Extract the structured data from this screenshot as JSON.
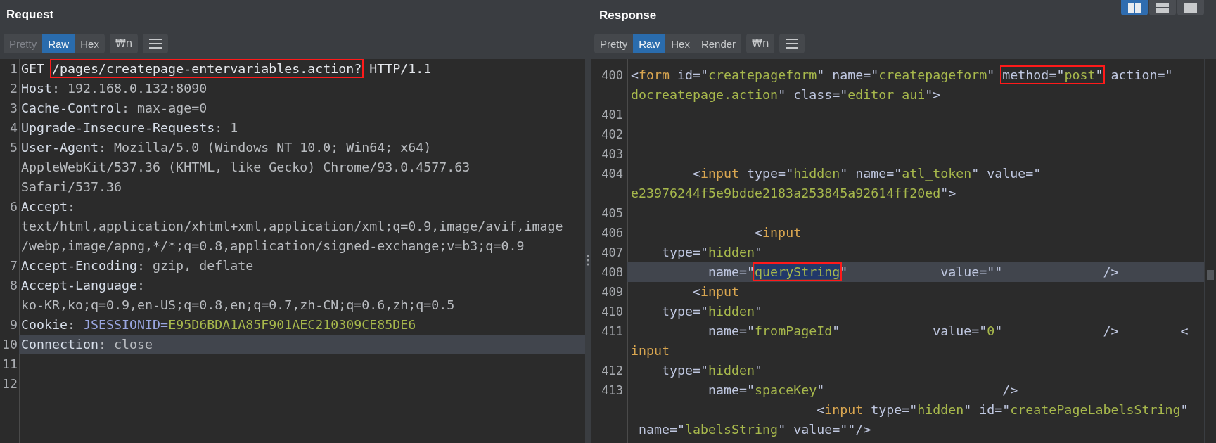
{
  "layout_buttons": [
    {
      "kind": "columns",
      "selected": true
    },
    {
      "kind": "rows",
      "selected": false
    },
    {
      "kind": "single",
      "selected": false
    }
  ],
  "request": {
    "title": "Request",
    "tabs": [
      {
        "label": "Pretty",
        "selected": false,
        "disabled": true
      },
      {
        "label": "Raw",
        "selected": true,
        "disabled": false
      },
      {
        "label": "Hex",
        "selected": false,
        "disabled": false
      }
    ],
    "wrap_button": "₩n",
    "rows": [
      {
        "number": "1",
        "current": false,
        "segments": [
          {
            "text": "GET ",
            "kind": "text"
          },
          {
            "kind": "box",
            "selected": false,
            "segments": [
              {
                "text": "/pages/createpage-entervariables.action?",
                "kind": "text"
              }
            ]
          },
          {
            "text": " HTTP/1.1",
            "kind": "text"
          }
        ]
      },
      {
        "number": "2",
        "current": false,
        "segments": [
          {
            "text": "Host",
            "kind": "name"
          },
          {
            "text": ": 192.168.0.132:8090",
            "kind": "plain"
          }
        ]
      },
      {
        "number": "3",
        "current": false,
        "segments": [
          {
            "text": "Cache-Control",
            "kind": "name"
          },
          {
            "text": ": max-age=0",
            "kind": "plain"
          }
        ]
      },
      {
        "number": "4",
        "current": false,
        "segments": [
          {
            "text": "Upgrade-Insecure-Requests",
            "kind": "name"
          },
          {
            "text": ": 1",
            "kind": "plain"
          }
        ]
      },
      {
        "number": "5",
        "current": false,
        "segments": [
          {
            "text": "User-Agent",
            "kind": "name"
          },
          {
            "text": ": Mozilla/5.0 (Windows NT 10.0; Win64; x64)",
            "kind": "plain"
          }
        ]
      },
      {
        "current": false,
        "segments": [
          {
            "text": "AppleWebKit/537.36 (KHTML, like Gecko) Chrome/93.0.4577.63",
            "kind": "plain"
          }
        ]
      },
      {
        "current": false,
        "segments": [
          {
            "text": "Safari/537.36",
            "kind": "plain"
          }
        ]
      },
      {
        "number": "6",
        "current": false,
        "segments": [
          {
            "text": "Accept",
            "kind": "name"
          },
          {
            "text": ":",
            "kind": "plain"
          }
        ]
      },
      {
        "current": false,
        "segments": [
          {
            "text": "text/html,application/xhtml+xml,application/xml;q=0.9,image/avif,image",
            "kind": "plain"
          }
        ]
      },
      {
        "current": false,
        "segments": [
          {
            "text": "/webp,image/apng,*/*;q=0.8,application/signed-exchange;v=b3;q=0.9",
            "kind": "plain"
          }
        ]
      },
      {
        "number": "7",
        "current": false,
        "segments": [
          {
            "text": "Accept-Encoding",
            "kind": "name"
          },
          {
            "text": ": gzip, deflate",
            "kind": "plain"
          }
        ]
      },
      {
        "number": "8",
        "current": false,
        "segments": [
          {
            "text": "Accept-Language",
            "kind": "name"
          },
          {
            "text": ":",
            "kind": "plain"
          }
        ]
      },
      {
        "current": false,
        "segments": [
          {
            "text": "ko-KR,ko;q=0.9,en-US;q=0.8,en;q=0.7,zh-CN;q=0.6,zh;q=0.5",
            "kind": "plain"
          }
        ]
      },
      {
        "number": "9",
        "current": false,
        "segments": [
          {
            "text": "Cookie",
            "kind": "name"
          },
          {
            "text": ": ",
            "kind": "plain"
          },
          {
            "text": "JSESSIONID=",
            "kind": "cookie_key"
          },
          {
            "text": "E95D6BDA1A85F901AEC210309CE85DE6",
            "kind": "value"
          }
        ]
      },
      {
        "number": "10",
        "current": true,
        "segments": [
          {
            "text": "Connection",
            "kind": "name"
          },
          {
            "text": ": close",
            "kind": "plain"
          }
        ]
      },
      {
        "number": "11",
        "current": false,
        "segments": []
      },
      {
        "number": "12",
        "current": false,
        "segments": []
      }
    ]
  },
  "response": {
    "title": "Response",
    "tabs": [
      {
        "label": "Pretty",
        "selected": false,
        "disabled": false
      },
      {
        "label": "Raw",
        "selected": true,
        "disabled": false
      },
      {
        "label": "Hex",
        "selected": false,
        "disabled": false
      },
      {
        "label": "Render",
        "selected": false,
        "disabled": false
      }
    ],
    "wrap_button": "₩n",
    "rows": [
      {
        "number": "400",
        "current": false,
        "segments": [
          {
            "text": "<",
            "kind": "attr"
          },
          {
            "text": "form",
            "kind": "tag"
          },
          {
            "text": " id=\"",
            "kind": "attr"
          },
          {
            "text": "createpageform",
            "kind": "value"
          },
          {
            "text": "\" name=\"",
            "kind": "attr"
          },
          {
            "text": "createpageform",
            "kind": "value"
          },
          {
            "text": "\" ",
            "kind": "attr"
          },
          {
            "kind": "box",
            "selected": false,
            "segments": [
              {
                "text": "method=\"",
                "kind": "attr"
              },
              {
                "text": "post",
                "kind": "value"
              },
              {
                "text": "\"",
                "kind": "attr"
              }
            ]
          },
          {
            "text": " action=\"",
            "kind": "attr"
          }
        ]
      },
      {
        "current": false,
        "segments": [
          {
            "text": "docreatepage.action",
            "kind": "value"
          },
          {
            "text": "\" class=\"",
            "kind": "attr"
          },
          {
            "text": "editor aui",
            "kind": "value"
          },
          {
            "text": "\">",
            "kind": "attr"
          }
        ]
      },
      {
        "number": "401",
        "current": false,
        "segments": []
      },
      {
        "number": "402",
        "current": false,
        "segments": []
      },
      {
        "number": "403",
        "current": false,
        "segments": []
      },
      {
        "number": "404",
        "current": false,
        "segments": [
          {
            "text": "        <",
            "kind": "attr"
          },
          {
            "text": "input",
            "kind": "tag"
          },
          {
            "text": " type=\"",
            "kind": "attr"
          },
          {
            "text": "hidden",
            "kind": "value"
          },
          {
            "text": "\" name=\"",
            "kind": "attr"
          },
          {
            "text": "atl_token",
            "kind": "value"
          },
          {
            "text": "\" value=\"",
            "kind": "attr"
          }
        ]
      },
      {
        "current": false,
        "segments": [
          {
            "text": "e23976244f5e9bdde2183a253845a92614ff20ed",
            "kind": "value"
          },
          {
            "text": "\">",
            "kind": "attr"
          }
        ]
      },
      {
        "number": "405",
        "current": false,
        "segments": []
      },
      {
        "number": "406",
        "current": false,
        "segments": [
          {
            "text": "                <",
            "kind": "attr"
          },
          {
            "text": "input",
            "kind": "tag"
          }
        ]
      },
      {
        "number": "407",
        "current": false,
        "segments": [
          {
            "text": "    type=\"",
            "kind": "attr"
          },
          {
            "text": "hidden",
            "kind": "value"
          },
          {
            "text": "\"",
            "kind": "attr"
          }
        ]
      },
      {
        "number": "408",
        "current": true,
        "segments": [
          {
            "text": "          name=\"",
            "kind": "attr"
          },
          {
            "kind": "box",
            "selected": true,
            "segments": [
              {
                "text": "queryString",
                "kind": "value"
              }
            ]
          },
          {
            "text": "\"            value=\"\"             />",
            "kind": "attr"
          }
        ]
      },
      {
        "number": "409",
        "current": false,
        "segments": [
          {
            "text": "        <",
            "kind": "attr"
          },
          {
            "text": "input",
            "kind": "tag"
          }
        ]
      },
      {
        "number": "410",
        "current": false,
        "segments": [
          {
            "text": "    type=\"",
            "kind": "attr"
          },
          {
            "text": "hidden",
            "kind": "value"
          },
          {
            "text": "\"",
            "kind": "attr"
          }
        ]
      },
      {
        "number": "411",
        "current": false,
        "segments": [
          {
            "text": "          name=\"",
            "kind": "attr"
          },
          {
            "text": "fromPageId",
            "kind": "value"
          },
          {
            "text": "\"            value=\"",
            "kind": "attr"
          },
          {
            "text": "0",
            "kind": "value"
          },
          {
            "text": "\"             />        <",
            "kind": "attr"
          }
        ]
      },
      {
        "current": false,
        "segments": [
          {
            "text": "input",
            "kind": "tag"
          }
        ]
      },
      {
        "number": "412",
        "current": false,
        "segments": [
          {
            "text": "    type=\"",
            "kind": "attr"
          },
          {
            "text": "hidden",
            "kind": "value"
          },
          {
            "text": "\"",
            "kind": "attr"
          }
        ]
      },
      {
        "number": "413",
        "current": false,
        "segments": [
          {
            "text": "          name=\"",
            "kind": "attr"
          },
          {
            "text": "spaceKey",
            "kind": "value"
          },
          {
            "text": "\"                       />",
            "kind": "attr"
          }
        ]
      },
      {
        "current": false,
        "segments": [
          {
            "text": "                        <",
            "kind": "attr"
          },
          {
            "text": "input",
            "kind": "tag"
          },
          {
            "text": " type=\"",
            "kind": "attr"
          },
          {
            "text": "hidden",
            "kind": "value"
          },
          {
            "text": "\" id=\"",
            "kind": "attr"
          },
          {
            "text": "createPageLabelsString",
            "kind": "value"
          },
          {
            "text": "\"",
            "kind": "attr"
          }
        ]
      },
      {
        "current": false,
        "segments": [
          {
            "text": " name=\"",
            "kind": "attr"
          },
          {
            "text": "labelsString",
            "kind": "value"
          },
          {
            "text": "\" value=\"\"/>",
            "kind": "attr"
          }
        ]
      }
    ]
  }
}
